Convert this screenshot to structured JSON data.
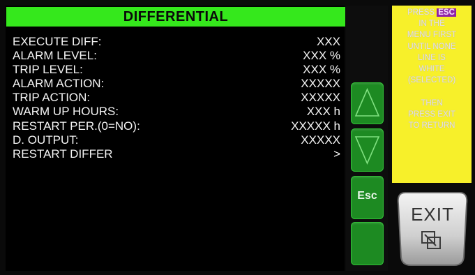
{
  "title": "DIFFERENTIAL",
  "settings": [
    {
      "label": "EXECUTE DIFF:",
      "value": "XXX"
    },
    {
      "label": "ALARM LEVEL:",
      "value": "XXX %"
    },
    {
      "label": "TRIP LEVEL:",
      "value": "XXX %"
    },
    {
      "label": "ALARM ACTION:",
      "value": "XXXXX"
    },
    {
      "label": "TRIP ACTION:",
      "value": "XXXXX"
    },
    {
      "label": "WARM UP HOURS:",
      "value": "XXX h"
    },
    {
      "label": "RESTART PER.(0=NO):",
      "value": "XXXXX h"
    },
    {
      "label": "D. OUTPUT:",
      "value": "XXXXX"
    },
    {
      "label": "RESTART DIFFER",
      "value": ">"
    }
  ],
  "side_buttons": {
    "up": {
      "icon": "up-arrow-icon"
    },
    "down": {
      "icon": "down-arrow-icon"
    },
    "esc": {
      "label": "Esc"
    },
    "blank": {
      "icon": ""
    }
  },
  "instructions": {
    "press": "PRESS",
    "esc_badge": "ESC",
    "lines": [
      "IN THE",
      "MENU FIRST",
      "UNTIL NONE",
      "LINE IS",
      "WHITE",
      "(SELECTED)",
      "",
      "THEN",
      "PRESS EXIT",
      "TO RETURN"
    ]
  },
  "exit_button": {
    "label": "EXIT",
    "icon": "window-exit-icon"
  },
  "colors": {
    "title_bg": "#35e81c",
    "screen_bg": "#000000",
    "button_green": "#1d8a22",
    "info_bg": "#f7f02a",
    "esc_badge_bg": "#8f1fa8"
  }
}
